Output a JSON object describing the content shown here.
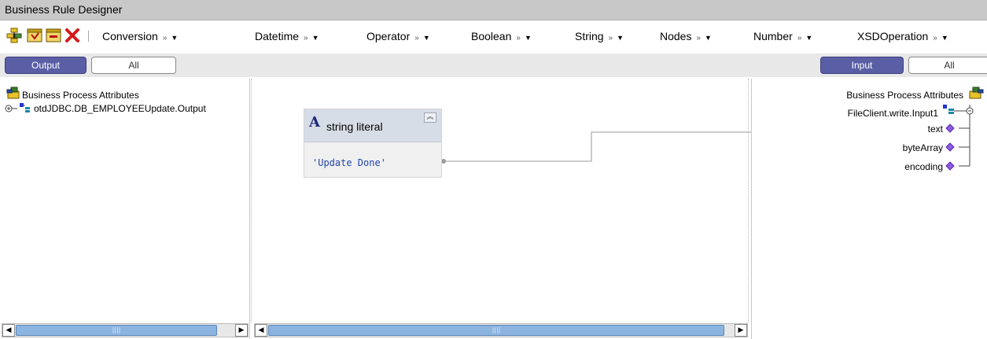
{
  "window": {
    "title": "Business Rule Designer"
  },
  "toolbar": {
    "icons": [
      "link-rules-icon",
      "add-rule-icon",
      "remove-rule-icon",
      "delete-icon"
    ],
    "menus": [
      {
        "label": "Conversion",
        "chevron": "»",
        "arrow": "▼"
      },
      {
        "label": "Datetime",
        "chevron": "»",
        "arrow": "▼"
      },
      {
        "label": "Operator",
        "chevron": "»",
        "arrow": "▼"
      },
      {
        "label": "Boolean",
        "chevron": "»",
        "arrow": "▼"
      },
      {
        "label": "String",
        "chevron": "»",
        "arrow": "▼"
      },
      {
        "label": "Nodes",
        "chevron": "»",
        "arrow": "▼"
      },
      {
        "label": "Number",
        "chevron": "»",
        "arrow": "▼"
      },
      {
        "label": "XSDOperation",
        "chevron": "»",
        "arrow": "▼"
      }
    ]
  },
  "output_pane": {
    "tab_active": "Output",
    "tab_other": "All",
    "root_label": "Business Process Attributes",
    "child_label": "otdJDBC.DB_EMPLOYEEUpdate.Output"
  },
  "input_pane": {
    "tab_active": "Input",
    "tab_other": "All",
    "root_label": "Business Process Attributes",
    "child_label": "FileClient.write.Input1",
    "fields": [
      "text",
      "byteArray",
      "encoding"
    ]
  },
  "canvas": {
    "node": {
      "title": "string literal",
      "value": "'Update Done'"
    }
  },
  "colors": {
    "tab_active": "#5a5fa5",
    "field_marker": "#8a5de0",
    "scroll_thumb": "#8cb4e0"
  }
}
